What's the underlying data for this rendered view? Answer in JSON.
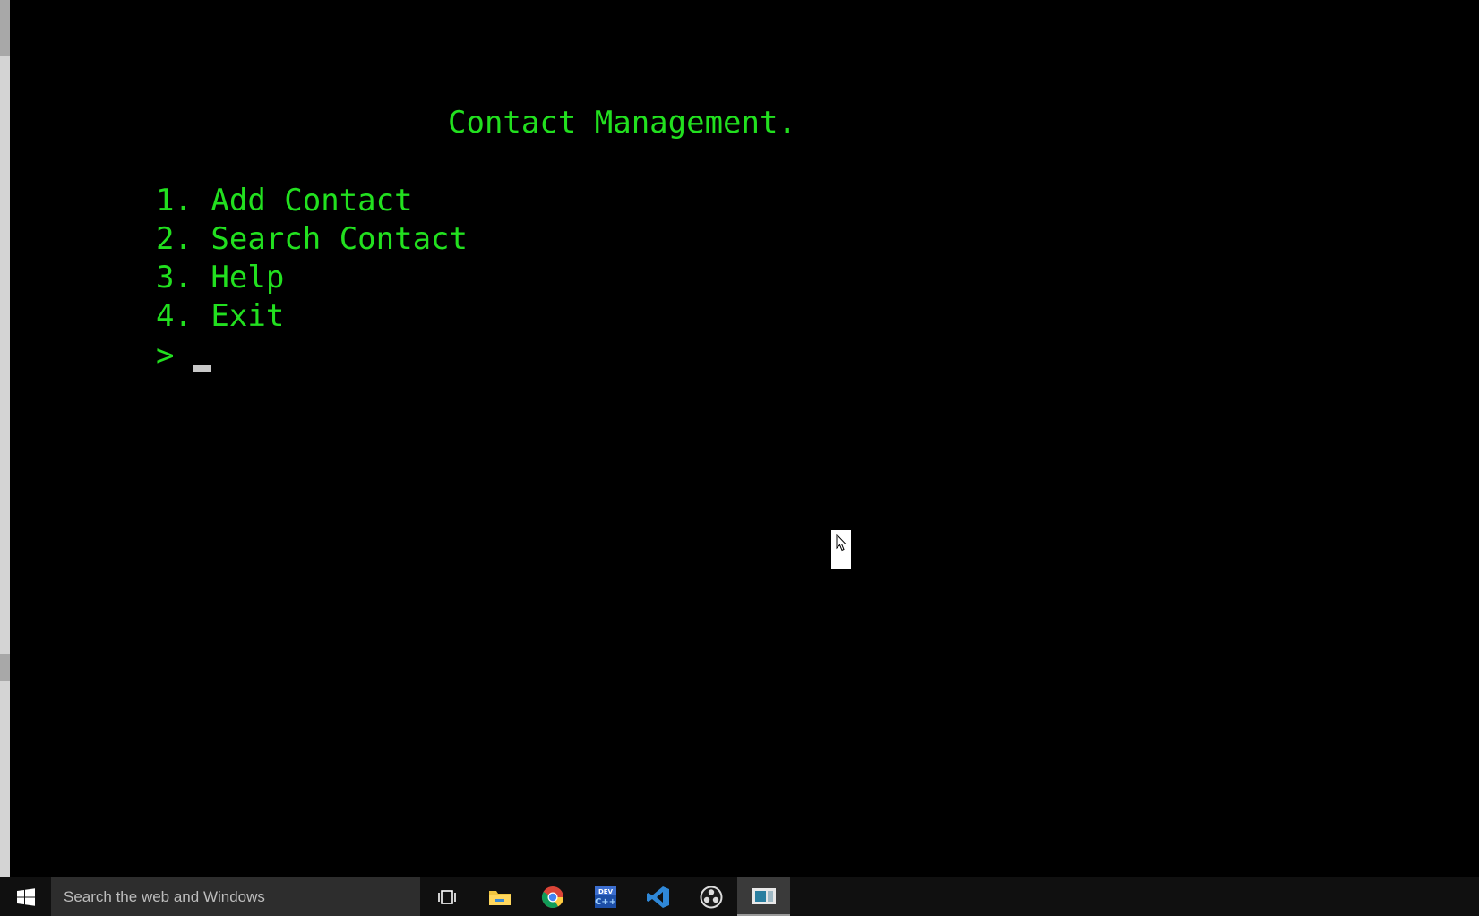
{
  "console": {
    "title": "Contact Management.",
    "menu": [
      "1. Add Contact",
      "2. Search Contact",
      "3. Help",
      "4. Exit"
    ],
    "prompt": ">",
    "text_color": "#22e01f",
    "background_color": "#000000"
  },
  "taskbar": {
    "search_placeholder": "Search the web and Windows",
    "icons": [
      "windows-start-icon",
      "task-view-icon",
      "file-explorer-icon",
      "chrome-icon",
      "dev-cpp-icon",
      "visual-studio-code-icon",
      "obs-icon",
      "console-app-icon"
    ]
  }
}
